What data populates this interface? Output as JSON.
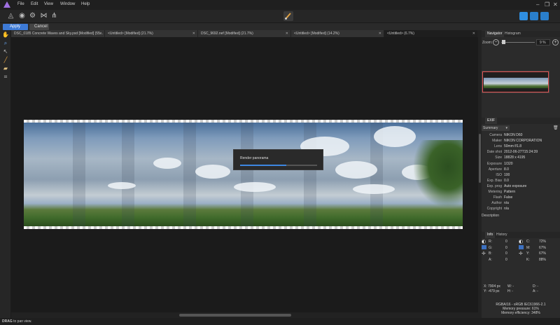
{
  "menu": [
    "File",
    "Edit",
    "View",
    "Window",
    "Help"
  ],
  "window_controls": [
    "–",
    "❐",
    "✕"
  ],
  "context": {
    "apply": "Apply",
    "cancel": "Cancel"
  },
  "tabs": [
    {
      "label": "DSC_0185 Concrete Waves and Sky.psd [Modified] (55...",
      "close": "✕"
    },
    {
      "label": "<Untitled> [Modified] (21.7%)",
      "close": "✕"
    },
    {
      "label": "DSC_9692.nef [Modified] (21.7%)",
      "close": "✕"
    },
    {
      "label": "<Untitled> [Modified] (14.2%)",
      "close": "✕"
    },
    {
      "label": "<Untitled> (6.7%)",
      "close": "✕"
    }
  ],
  "dialog": {
    "title": "Render panorama",
    "progress": 0.6
  },
  "navigator": {
    "tabs": [
      "Navigator",
      "Histogram"
    ],
    "zoom_label": "Zoom:",
    "zoom_value": "9 %"
  },
  "exif": {
    "tab": "EXIF",
    "mode": "Summary",
    "rows": [
      {
        "k": "Camera",
        "v": "NIKON D60"
      },
      {
        "k": "Maker",
        "v": "NIKON CORPORATION"
      },
      {
        "k": "Lens",
        "v": "50mm f/1.8"
      },
      {
        "k": "Date shot",
        "v": "2012-06-27T15:24:39"
      },
      {
        "k": "Size",
        "v": "18828 x 4195"
      },
      {
        "k": "Exposure",
        "v": "1/320"
      },
      {
        "k": "Aperture",
        "v": "8.0"
      },
      {
        "k": "ISO",
        "v": "100"
      },
      {
        "k": "Exp. Bias",
        "v": "0.0"
      },
      {
        "k": "Exp. prog",
        "v": "Auto exposure"
      },
      {
        "k": "Metering",
        "v": "Pattern"
      },
      {
        "k": "Flash",
        "v": "False"
      },
      {
        "k": "Author",
        "v": "n/a"
      },
      {
        "k": "Copyright",
        "v": "n/a"
      }
    ],
    "description_label": "Description"
  },
  "info": {
    "tabs": [
      "Info",
      "History"
    ],
    "left": [
      {
        "k": "R:",
        "v": "0"
      },
      {
        "k": "G:",
        "v": "0"
      },
      {
        "k": "B:",
        "v": "0"
      },
      {
        "k": "A:",
        "v": "0"
      }
    ],
    "right": [
      {
        "k": "C:",
        "v": "72%"
      },
      {
        "k": "M:",
        "v": "67%"
      },
      {
        "k": "Y:",
        "v": "67%"
      },
      {
        "k": "K:",
        "v": "88%"
      }
    ],
    "coords": [
      "X: 7904 px",
      "Y: -479 px",
      "W: -",
      "H: -",
      "D: -",
      "A: -"
    ],
    "color_mode": "RGBA/16 - sRGB IEC61966-2.1",
    "memory_pressure": "Memory pressure: 61%",
    "memory_efficiency": "Memory efficiency: 348%"
  },
  "status": {
    "bold": "DRAG",
    "text": " to pan view."
  }
}
